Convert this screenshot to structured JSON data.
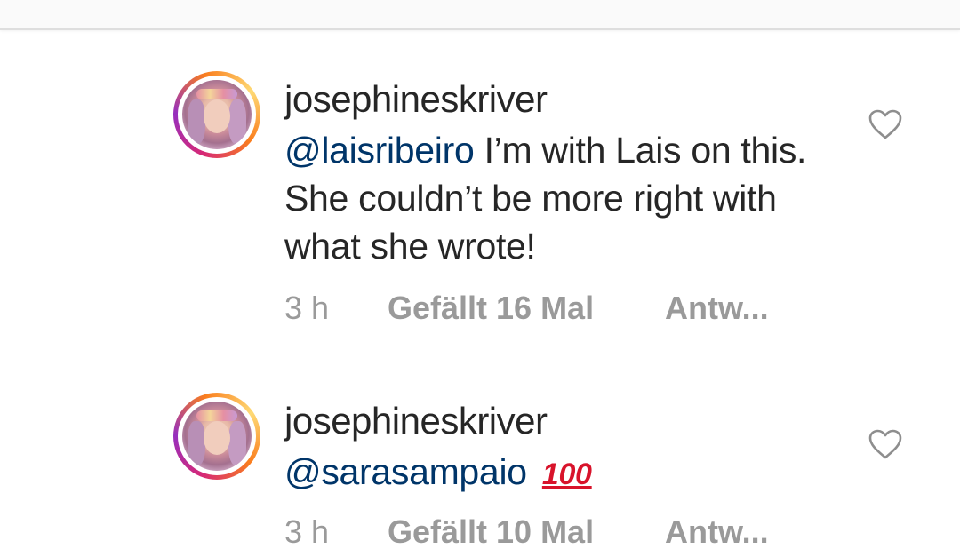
{
  "comments": [
    {
      "username": "josephineskriver",
      "mention": "@laisribeiro",
      "text": " I’m with Lais on this. She couldn’t be more right with what she wrote!",
      "time": "3 h",
      "likes": "Gefällt 16 Mal",
      "reply": "Antw...",
      "emoji": ""
    },
    {
      "username": "josephineskriver",
      "mention": "@sarasampaio",
      "text": "",
      "emoji": "100",
      "time": "3 h",
      "likes": "Gefällt 10 Mal",
      "reply": "Antw..."
    }
  ],
  "icons": {
    "like": "heart-outline-icon",
    "emoji": "hundred-points-emoji"
  },
  "colors": {
    "text": "#262626",
    "mention": "#003569",
    "meta": "#9a9a9a",
    "emoji": "#d8132b"
  }
}
